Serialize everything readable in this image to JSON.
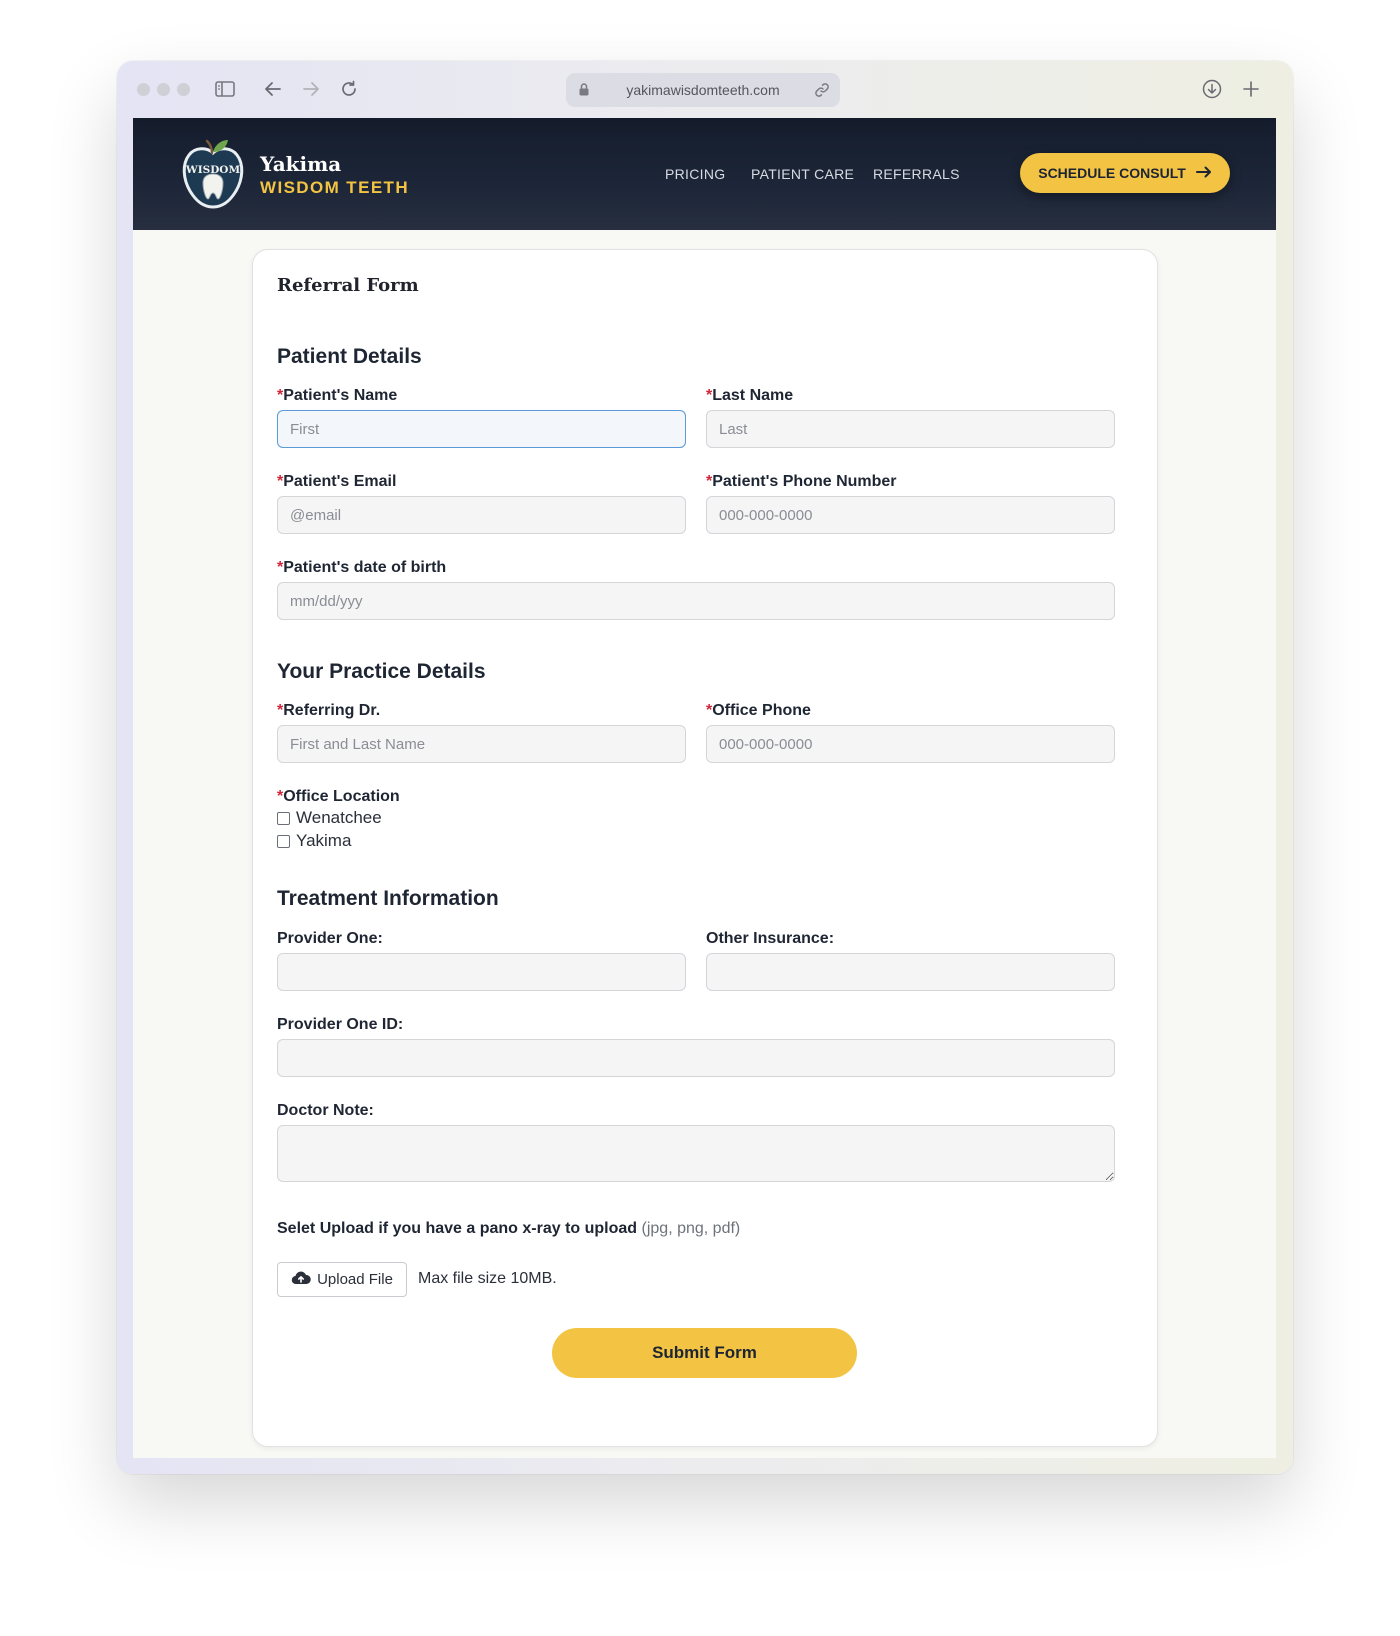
{
  "browser": {
    "url": "yakimawisdomteeth.com"
  },
  "header": {
    "brand_line1": "Yakima",
    "brand_line2": "WISDOM TEETH",
    "logo_text": "WISDOM",
    "nav": [
      "PRICING",
      "PATIENT CARE",
      "REFERRALS"
    ],
    "cta_label": "SCHEDULE CONSULT"
  },
  "form": {
    "title": "Referral Form",
    "required_mark": "*",
    "sections": {
      "patient": "Patient Details",
      "practice": "Your Practice Details",
      "treatment": "Treatment Information"
    },
    "fields": {
      "first_name": {
        "label": "Patient's Name",
        "placeholder": "First",
        "value": ""
      },
      "last_name": {
        "label": "Last Name",
        "placeholder": "Last",
        "value": ""
      },
      "email": {
        "label": "Patient's Email",
        "placeholder": "@email",
        "value": ""
      },
      "phone": {
        "label": "Patient's Phone Number",
        "placeholder": "000-000-0000",
        "value": ""
      },
      "dob": {
        "label": "Patient's date of birth",
        "placeholder": "mm/dd/yyy",
        "value": ""
      },
      "referring_dr": {
        "label": "Referring Dr.",
        "placeholder": "First and Last Name",
        "value": ""
      },
      "office_phone": {
        "label": "Office Phone",
        "placeholder": "000-000-0000",
        "value": ""
      },
      "provider_one": {
        "label": "Provider One:",
        "value": ""
      },
      "other_insurance": {
        "label": "Other Insurance:",
        "value": ""
      },
      "provider_one_id": {
        "label": "Provider One ID:",
        "value": ""
      },
      "doctor_note": {
        "label": "Doctor Note:",
        "value": ""
      }
    },
    "office_location": {
      "label": "Office Location",
      "options": [
        "Wenatchee",
        "Yakima"
      ]
    },
    "upload": {
      "prompt": "Selet Upload if you have a pano x-ray to upload",
      "types": "(jpg, png, pdf)",
      "button_label": "Upload File",
      "note": "Max file size 10MB."
    },
    "submit_label": "Submit Form"
  },
  "colors": {
    "accent": "#f3c443",
    "header_bg": "#1a2233",
    "required": "#d0263a",
    "focus": "#5a9ad6"
  },
  "icons": {
    "toolbar": [
      "sidebar-icon",
      "back-arrow-icon",
      "forward-arrow-icon",
      "reload-icon",
      "lock-icon",
      "link-icon",
      "download-icon",
      "plus-icon"
    ],
    "cta": "arrow-right-icon",
    "upload": "cloud-upload-icon"
  }
}
